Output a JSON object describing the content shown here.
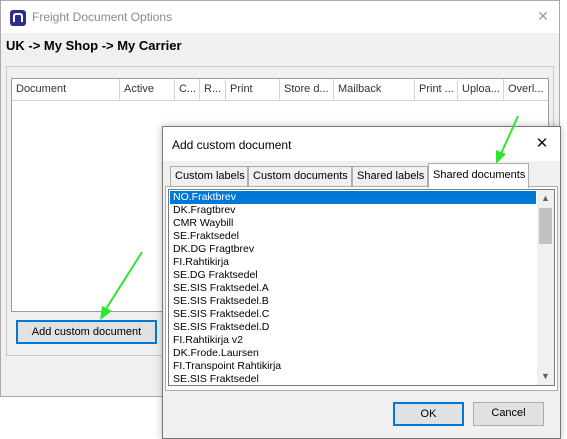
{
  "main_window": {
    "title": "Freight Document Options",
    "breadcrumb": "UK -> My Shop -> My Carrier",
    "table_columns": [
      "Document",
      "Active",
      "C...",
      "R...",
      "Print",
      "Store d...",
      "Mailback",
      "Print ...",
      "Uploa...",
      "Overl..."
    ],
    "add_custom_label": "Add custom document"
  },
  "dialog": {
    "title": "Add custom document",
    "tabs": [
      "Custom labels",
      "Custom documents",
      "Shared labels",
      "Shared documents"
    ],
    "active_tab": "Shared documents",
    "items": [
      "NO.Fraktbrev",
      "DK.Fragtbrev",
      "CMR Waybill",
      "SE.Fraktsedel",
      "DK.DG Fragtbrev",
      "FI.Rahtikirja",
      "SE.DG Fraktsedel",
      "SE.SIS Fraktsedel.A",
      "SE.SIS Fraktsedel.B",
      "SE.SIS Fraktsedel.C",
      "SE.SIS Fraktsedel.D",
      "FI.Rahtikirja v2",
      "DK.Frode.Laursen",
      "FI.Transpoint Rahtikirja",
      "SE.SIS Fraktsedel"
    ],
    "selected_item": "NO.Fraktbrev",
    "ok_label": "OK",
    "cancel_label": "Cancel"
  },
  "icons": {
    "app": "app-logo-icon",
    "close": "close-icon",
    "scroll_up": "chevron-up-icon",
    "scroll_down": "chevron-down-icon",
    "annotation": "arrow-icon"
  },
  "colors": {
    "selection": "#0078d7",
    "annotation_arrow": "#2ee62e",
    "app_icon": "#2d2d8c"
  }
}
